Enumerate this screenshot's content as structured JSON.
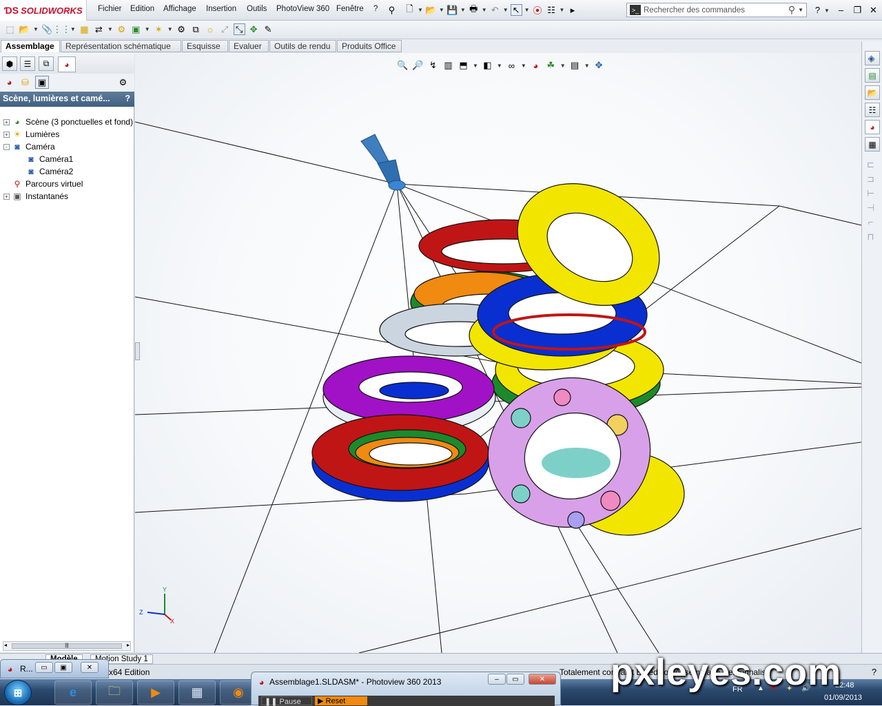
{
  "app": {
    "brand": "SOLIDWORKS",
    "menus": [
      "Fichier",
      "Edition",
      "Affichage",
      "Insertion",
      "Outils",
      "PhotoView 360",
      "Fenêtre",
      "?"
    ],
    "search_placeholder": "Rechercher des commandes",
    "help_label": "?"
  },
  "command_tabs": [
    "Assemblage",
    "Représentation schématique",
    "Esquisse",
    "Evaluer",
    "Outils de rendu",
    "Produits Office"
  ],
  "panel": {
    "header": "Scène, lumières et camé...",
    "help": "?",
    "tree": [
      {
        "label": "Scène (3 ponctuelles et fond)",
        "expander": "+",
        "icon": "scene-icon",
        "indent": 0
      },
      {
        "label": "Lumières",
        "expander": "+",
        "icon": "lights-icon",
        "indent": 0
      },
      {
        "label": "Caméra",
        "expander": "-",
        "icon": "camera-icon",
        "indent": 0
      },
      {
        "label": "Caméra1",
        "expander": "",
        "icon": "camera-icon",
        "indent": 1
      },
      {
        "label": "Caméra2",
        "expander": "",
        "icon": "camera-icon",
        "indent": 1
      },
      {
        "label": "Parcours virtuel",
        "expander": "",
        "icon": "walkthrough-icon",
        "indent": 0
      },
      {
        "label": "Instantanés",
        "expander": "+",
        "icon": "snapshot-icon",
        "indent": 0
      }
    ]
  },
  "bottom_tabs": [
    "Modèle",
    "Motion Study 1"
  ],
  "status": {
    "edition": "x64 Edition",
    "right_text": "Totalement contraint   En édition Assemblage   Personnalisé"
  },
  "minimized_window": {
    "title": "R..."
  },
  "photoview_window": {
    "title": "Assemblage1.SLDASM* - Photoview 360 2013",
    "pause": "Pause",
    "reset": "Reset"
  },
  "tray": {
    "lang": "FR",
    "time": "22:48",
    "date": "01/09/2013"
  },
  "watermark": "pxleyes.com",
  "colors": {
    "red": "#c01515",
    "yellow": "#f2e600",
    "blue": "#0a2fd0",
    "purple": "#a111c6",
    "green": "#1c8a2a",
    "orange": "#f08a10",
    "white": "#e8eef5"
  }
}
